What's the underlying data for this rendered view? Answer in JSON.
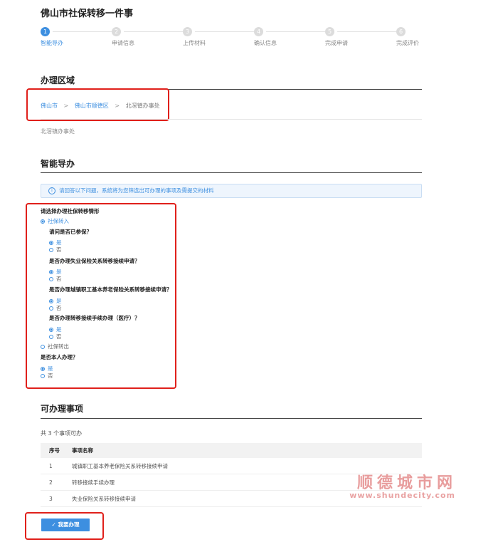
{
  "page_title": "佛山市社保转移一件事",
  "steps": [
    {
      "num": "1",
      "label": "智能导办",
      "active": true
    },
    {
      "num": "2",
      "label": "申请信息",
      "active": false
    },
    {
      "num": "3",
      "label": "上传材料",
      "active": false
    },
    {
      "num": "4",
      "label": "确认信息",
      "active": false
    },
    {
      "num": "5",
      "label": "完成申请",
      "active": false
    },
    {
      "num": "6",
      "label": "完成评价",
      "active": false
    }
  ],
  "region": {
    "heading": "办理区域",
    "breadcrumb": [
      "佛山市",
      "佛山市顺德区",
      "北滘镇办事处"
    ],
    "separator": ">",
    "selected": "北滘镇办事处"
  },
  "guide": {
    "heading": "智能导办",
    "notice": "请回答以下问题，系统将为您筛选出可办理的事项及需提交的材料",
    "question_main": "请选择办理社保转移情形",
    "option_in": "社保转入",
    "sub_questions": [
      {
        "q": "请问是否已参保？",
        "options": [
          "是",
          "否"
        ]
      },
      {
        "q": "是否办理失业保险关系转移接续申请？",
        "options": [
          "是",
          "否"
        ]
      },
      {
        "q": "是否办理城镇职工基本养老保险关系转移接续申请？",
        "options": [
          "是",
          "否"
        ]
      },
      {
        "q": "是否办理转移接续手续办理（医疗）？",
        "options": [
          "是",
          "否"
        ]
      }
    ],
    "option_out": "社保转出",
    "self_question": "是否本人办理？",
    "self_options": [
      "是",
      "否"
    ]
  },
  "items": {
    "heading": "可办理事项",
    "count_text": "共 3 个事项可办",
    "columns": [
      "序号",
      "事项名称"
    ],
    "rows": [
      {
        "no": "1",
        "name": "城镇职工基本养老保险关系转移接续申请"
      },
      {
        "no": "2",
        "name": "转移接续手续办理"
      },
      {
        "no": "3",
        "name": "失业保险关系转移接续申请"
      }
    ]
  },
  "submit_button": "✓ 我要办理",
  "watermark": {
    "cn": "顺德城市网",
    "url": "www.shundecity.com"
  },
  "colors": {
    "accent": "#3d8fe0",
    "highlight": "#e0201b"
  }
}
